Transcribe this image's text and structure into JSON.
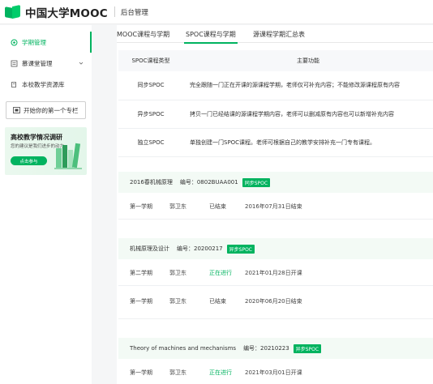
{
  "header": {
    "logo_text": "中国大学MOOC",
    "section": "后台管理"
  },
  "sidebar": {
    "items": [
      {
        "label": "学期管理",
        "icon": "grid-icon",
        "active": true
      },
      {
        "label": "慕课堂管理",
        "icon": "list-icon",
        "expandable": true
      },
      {
        "label": "本校教学资源库",
        "icon": "book-icon"
      }
    ],
    "start_button": "开始你的第一个专栏",
    "banner": {
      "title": "高校教学情况调研",
      "desc": "您的建议是我们进步的动力",
      "button": "点击参与"
    }
  },
  "tabs": [
    "MOOC课程与学期",
    "SPOC课程与学期",
    "源课程学期汇总表"
  ],
  "active_tab": "SPOC课程与学期",
  "type_table": {
    "headers": [
      "SPOC课程类型",
      "主要功能"
    ],
    "rows": [
      {
        "type": "同步SPOC",
        "desc": "完全跟随一门正在开课的源课程学期，老师仅可补充内容；不能修改源课程原有内容"
      },
      {
        "type": "异步SPOC",
        "desc": "拷贝一门已经结课的源课程学期内容，老师可以删减原有内容也可以新增补充内容"
      },
      {
        "type": "独立SPOC",
        "desc": "单独创建一门SPOC课程。老师可根据自己的教学安排补充一门专有课程。"
      }
    ]
  },
  "courses": [
    {
      "name": "2016春机械原理",
      "code_label": "编号：0802BUAA001",
      "tag": "同步SPOC",
      "terms": [
        {
          "term": "第一学期",
          "teacher": "郭卫东",
          "status": "已结束",
          "status_type": "ended",
          "date": "2016年07月31日结束"
        }
      ]
    },
    {
      "name": "机械原理及设计",
      "code_label": "编号：20200217",
      "tag": "异步SPOC",
      "terms": [
        {
          "term": "第二学期",
          "teacher": "郭卫东",
          "status": "正在进行",
          "status_type": "running",
          "date": "2021年01月28日开课"
        },
        {
          "term": "第一学期",
          "teacher": "郭卫东",
          "status": "已结束",
          "status_type": "ended",
          "date": "2020年06月20日结束"
        }
      ]
    },
    {
      "name": "Theory of machines and mechanisms",
      "code_label": "编号：20210223",
      "tag": "异步SPOC",
      "terms": [
        {
          "term": "第一学期",
          "teacher": "郭卫东",
          "status": "正在进行",
          "status_type": "running",
          "date": "2021年03月01日开课"
        }
      ]
    }
  ],
  "colors": {
    "accent": "#00b35f",
    "course_head_bg": "#f3faf5",
    "page_bg": "#f5f6f7"
  }
}
